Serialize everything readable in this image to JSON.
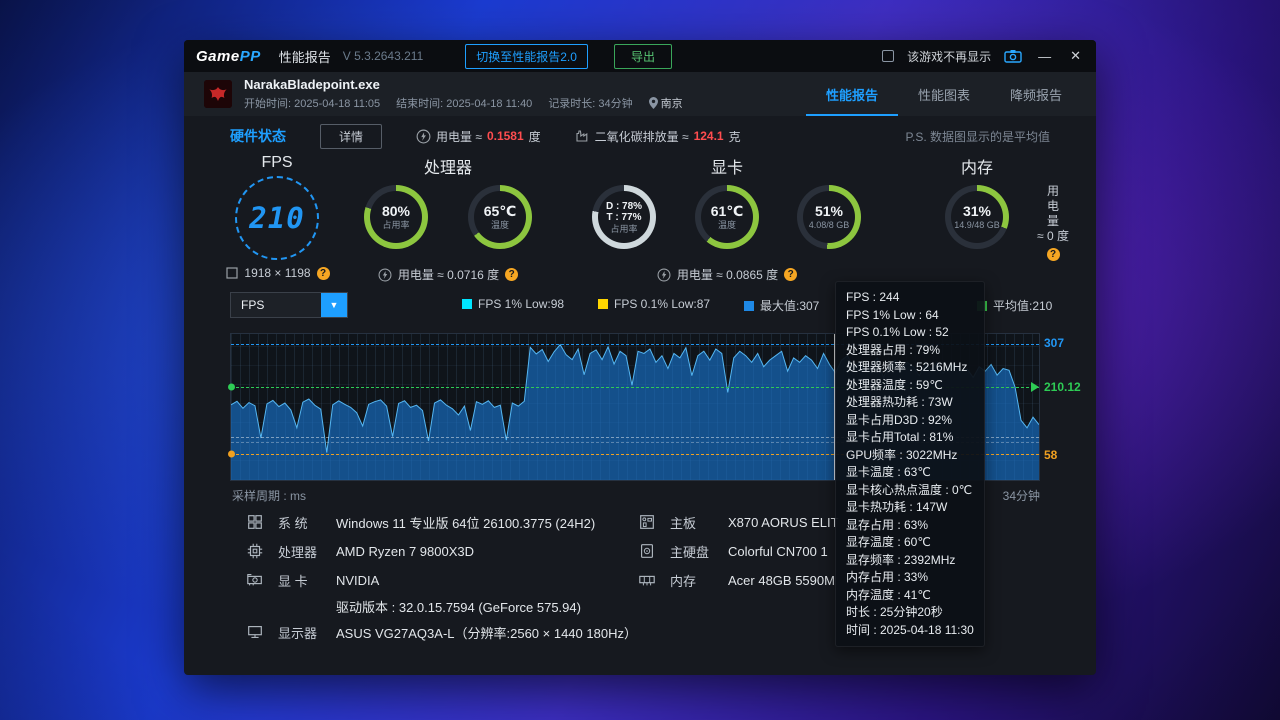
{
  "titlebar": {
    "logo_game": "Game",
    "logo_pp": "PP",
    "title": "性能报告",
    "version": "V 5.3.2643.211",
    "switch_button": "切换至性能报告2.0",
    "export_button": "导出",
    "checkbox_label": "该游戏不再显示",
    "minimize_label": "—",
    "close_label": "✕"
  },
  "game": {
    "exe": "NarakaBladepoint.exe",
    "start": "开始时间: 2025-04-18 11:05",
    "end": "结束时间: 2025-04-18 11:40",
    "duration": "记录时长: 34分钟",
    "location": "南京",
    "tabs": [
      {
        "label": "性能报告"
      },
      {
        "label": "性能图表"
      },
      {
        "label": "降频报告"
      }
    ]
  },
  "hardware": {
    "title": "硬件状态",
    "details_button": "详情",
    "power_prefix": "用电量 ≈",
    "power_value": "0.1581",
    "power_suffix": "度",
    "co2_prefix": "二氧化碳排放量 ≈",
    "co2_value": "124.1",
    "co2_suffix": "克",
    "note": "P.S. 数据图显示的是平均值"
  },
  "gauges": {
    "fps": {
      "title": "FPS",
      "value": "210",
      "resolution": "1918 × 1198"
    },
    "cpu": {
      "title": "处理器",
      "usage": {
        "value": "80%",
        "label": "占用率",
        "pct": 80,
        "color": "#8dc63f"
      },
      "temp": {
        "value": "65℃",
        "label": "温度",
        "pct": 65,
        "color": "#8dc63f"
      },
      "power": "用电量 ≈ 0.0716 度"
    },
    "gpu": {
      "title": "显卡",
      "usage": {
        "line1": "D : 78%",
        "line2": "T : 77%",
        "label": "占用率",
        "pct": 78,
        "color": "#cfd8dc"
      },
      "temp": {
        "value": "61℃",
        "label": "温度",
        "pct": 61,
        "color": "#8dc63f"
      },
      "vram": {
        "value": "51%",
        "label": "4.08/8 GB",
        "pct": 51,
        "color": "#8dc63f"
      },
      "power": "用电量 ≈ 0.0865 度"
    },
    "mem": {
      "title": "内存",
      "usage": {
        "value": "31%",
        "label": "14.9/48 GB",
        "pct": 31,
        "color": "#8dc63f"
      },
      "power_lines": [
        "用",
        "电",
        "量",
        "≈ 0 度"
      ]
    }
  },
  "chart": {
    "selector_value": "FPS",
    "caret": "▼",
    "legend": [
      {
        "color": "#00e5ff",
        "label": "FPS 1% Low:98"
      },
      {
        "color": "#ffd600",
        "label": "FPS 0.1% Low:87"
      },
      {
        "color": "#1e88e5",
        "label": "最大值:307"
      },
      {
        "color": "#3ecf4e",
        "label": "平均值:210"
      }
    ],
    "x_label": "采样周期 : ms",
    "x_end_label": "34分钟"
  },
  "chart_data": {
    "type": "area",
    "title": "FPS over time",
    "ylabel": "FPS",
    "ylim": [
      0,
      330
    ],
    "x_range_label": "34分钟",
    "values": [
      170,
      178,
      162,
      175,
      168,
      95,
      172,
      180,
      166,
      174,
      158,
      118,
      176,
      183,
      169,
      160,
      62,
      170,
      179,
      171,
      164,
      152,
      122,
      171,
      177,
      181,
      167,
      98,
      173,
      179,
      164,
      169,
      157,
      88,
      174,
      181,
      169,
      161,
      147,
      167,
      112,
      177,
      171,
      179,
      164,
      169,
      90,
      174,
      167,
      178,
      300,
      285,
      295,
      268,
      290,
      306,
      283,
      272,
      296,
      238,
      286,
      294,
      272,
      301,
      262,
      291,
      281,
      214,
      291,
      286,
      296,
      266,
      281,
      252,
      286,
      276,
      299,
      236,
      281,
      291,
      271,
      296,
      286,
      198,
      276,
      291,
      281,
      266,
      286,
      256,
      271,
      281,
      291,
      246,
      276,
      266,
      281,
      271,
      252,
      286,
      261,
      242,
      271,
      281,
      256,
      266,
      246,
      261,
      276,
      232,
      261,
      271,
      251,
      266,
      256,
      236,
      261,
      251,
      266,
      241,
      256,
      261,
      246,
      251,
      232,
      256,
      246,
      261,
      237,
      252,
      248,
      210,
      135,
      118,
      142,
      125
    ],
    "markers": [
      {
        "value": 307,
        "label": "307",
        "color": "#2196f3"
      },
      {
        "value": 210.12,
        "label": "210.12",
        "color": "#2ecc55",
        "dot": true,
        "arrow": true
      },
      {
        "value": 98,
        "label": "",
        "color": "rgba(255,255,255,0.45)"
      },
      {
        "value": 87,
        "label": "",
        "color": "rgba(255,255,255,0.30)"
      },
      {
        "value": 58,
        "label": "58",
        "color": "#f0a020",
        "dot": true
      }
    ],
    "crosshair_pct": 74.6
  },
  "tooltip": {
    "lines": [
      "FPS : 244",
      "FPS 1% Low : 64",
      "FPS 0.1% Low : 52",
      "处理器占用 : 79%",
      "处理器频率 : 5216MHz",
      "处理器温度 : 59℃",
      "处理器热功耗 : 73W",
      "显卡占用D3D : 92%",
      "显卡占用Total : 81%",
      "GPU频率 : 3022MHz",
      "显卡温度 : 63℃",
      "显卡核心热点温度 : 0℃",
      "显卡热功耗 : 147W",
      "显存占用 : 63%",
      "显存温度 : 60℃",
      "显存频率 : 2392MHz",
      "内存占用 : 33%",
      "内存温度 : 41℃",
      "时长 : 25分钟20秒",
      "时间 : 2025-04-18 11:30"
    ]
  },
  "sysinfo": {
    "left": [
      {
        "label": "系 统",
        "value": "Windows 11 专业版 64位 26100.3775 (24H2)"
      },
      {
        "label": "处理器",
        "value": "AMD Ryzen 7 9800X3D"
      },
      {
        "label": "显 卡",
        "value": "NVIDIA"
      },
      {
        "label": "",
        "value": "驱动版本 : 32.0.15.7594 (GeForce 575.94)"
      },
      {
        "label": "显示器",
        "value": "ASUS VG27AQ3A-L（分辨率:2560 × 1440 180Hz）"
      }
    ],
    "right": [
      {
        "label": "主板",
        "value": "X870 AORUS ELIT"
      },
      {
        "label": "主硬盘",
        "value": "Colorful CN700 1"
      },
      {
        "label": "内存",
        "value": "Acer 48GB 5590M"
      }
    ]
  }
}
